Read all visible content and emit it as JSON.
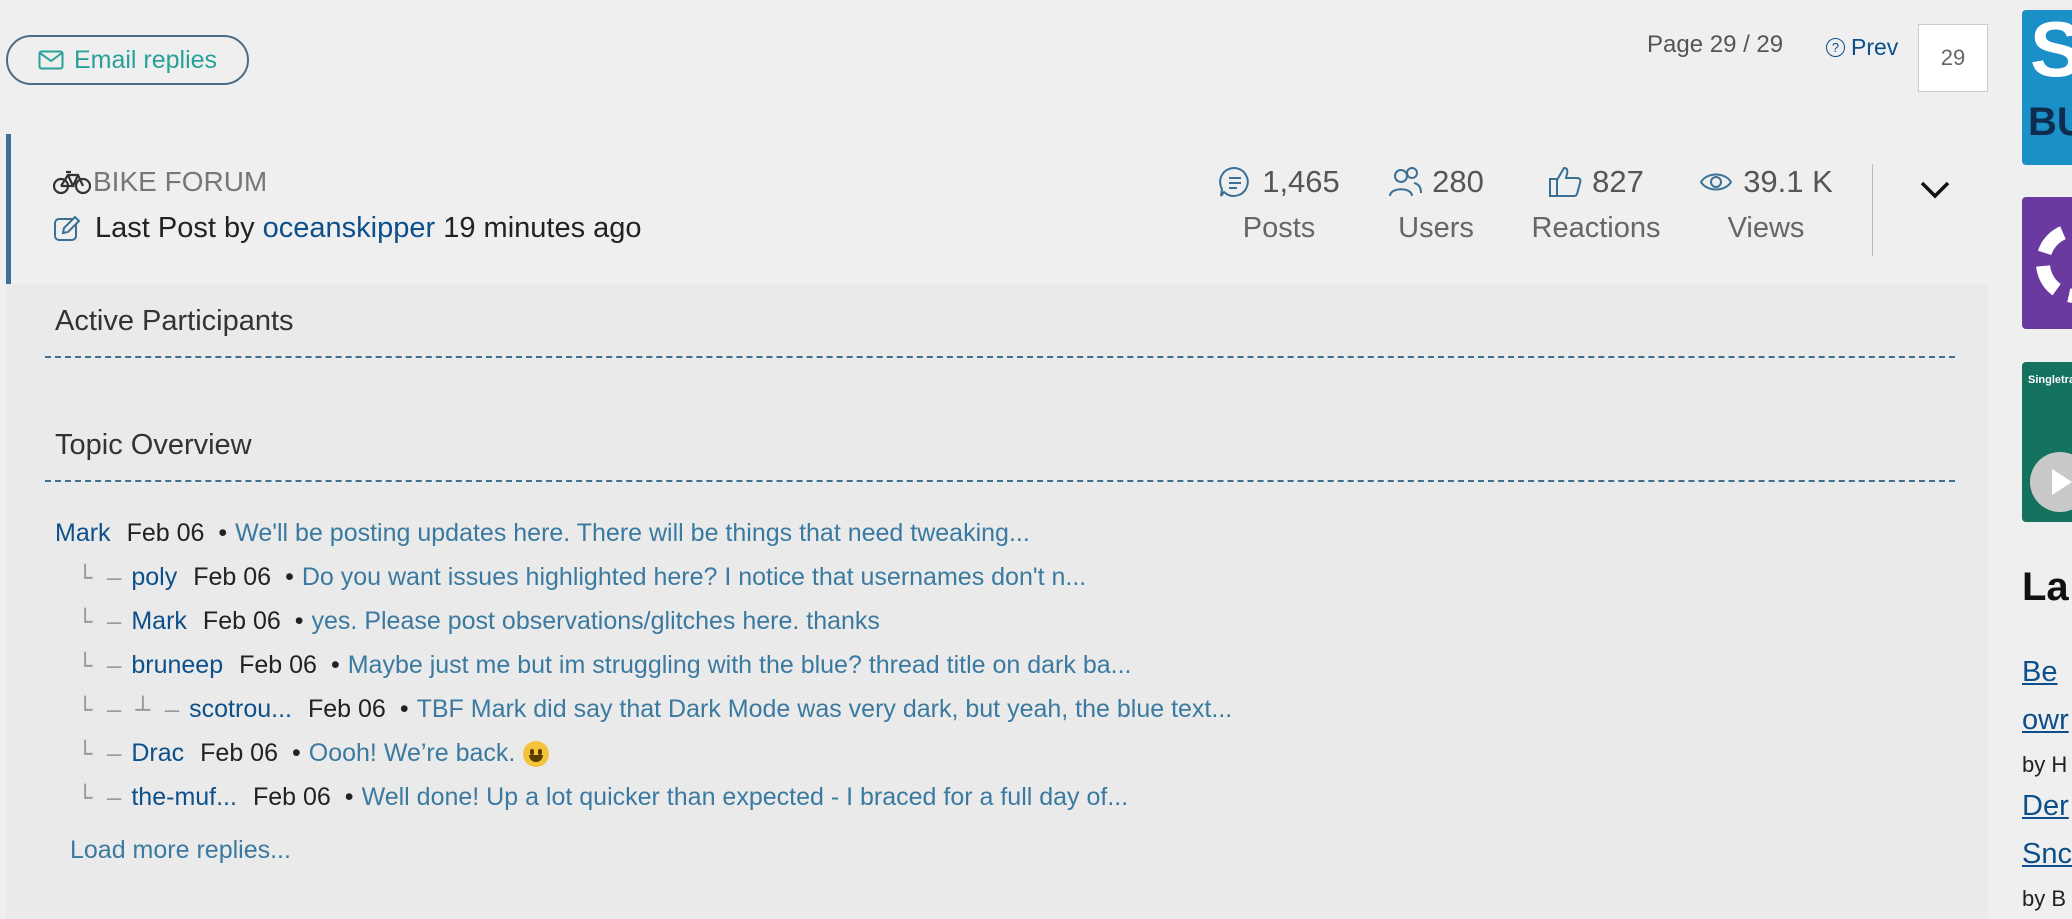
{
  "top_bar": {
    "email_button_label": "Email replies",
    "page_label": "Page 29 / 29",
    "prev_label": "Prev",
    "page_input_value": "29"
  },
  "topic_header": {
    "forum_name": "BIKE FORUM",
    "last_post_prefix": "Last Post by",
    "last_post_user": "oceanskipper",
    "last_post_time": "19 minutes ago",
    "stats": [
      {
        "icon": "posts-icon",
        "value": "1,465",
        "label": "Posts"
      },
      {
        "icon": "users-icon",
        "value": "280",
        "label": "Users"
      },
      {
        "icon": "thumbs-up-icon",
        "value": "827",
        "label": "Reactions"
      },
      {
        "icon": "eye-icon",
        "value": "39.1 K",
        "label": "Views"
      }
    ]
  },
  "sections": {
    "active_participants": "Active Participants",
    "topic_overview": "Topic Overview"
  },
  "replies": [
    {
      "tree": "",
      "author": "Mark",
      "date": "Feb 06",
      "sep": "•",
      "snippet": "We'll be posting updates here. There will be things that need tweaking..."
    },
    {
      "tree": "└ —",
      "author": "poly",
      "date": "Feb 06",
      "sep": "•",
      "snippet": "Do you want issues highlighted here? I notice that usernames don't n..."
    },
    {
      "tree": "└ —",
      "author": "Mark",
      "date": "Feb 06",
      "sep": "•",
      "snippet": "yes. Please post observations/glitches here. thanks"
    },
    {
      "tree": "└ —",
      "author": "bruneep",
      "date": "Feb 06",
      "sep": "•",
      "snippet": "Maybe just me but im struggling with the blue? thread title on dark ba..."
    },
    {
      "tree": "└ —  ┴ —",
      "author": "scotrou...",
      "date": "Feb 06",
      "sep": "•",
      "snippet": "TBF Mark did say that Dark Mode was very dark, but yeah, the blue text..."
    },
    {
      "tree": "└ —",
      "author": "Drac",
      "date": "Feb 06",
      "sep": "•",
      "snippet": "Oooh! We’re back."
    },
    {
      "tree": "└ —",
      "author": "the-muf...",
      "date": "Feb 06",
      "sep": "•",
      "snippet": "Well done! Up a lot quicker than expected - I braced for a full day of..."
    }
  ],
  "load_more_label": "Load more replies...",
  "sidebar": {
    "ad1_big": "S",
    "ad1_small": "BU",
    "ad3_title": "Singletra",
    "latest_heading": "La",
    "links": [
      {
        "line1": "Be ",
        "line2": "owr",
        "by": "by H"
      },
      {
        "line1": "Der",
        "line2": "Snc",
        "by": "by B"
      }
    ]
  },
  "colors": {
    "accent_teal": "#2aa198",
    "link_blue": "#0c4f8a",
    "snippet_blue": "#3a7aa0",
    "header_border": "#3a6f96"
  }
}
